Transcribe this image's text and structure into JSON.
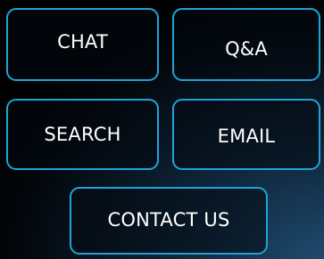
{
  "buttons": {
    "chat": "CHAT",
    "qa": "Q&A",
    "search": "SEARCH",
    "email": "EMAIL",
    "contact": "CONTACT US"
  },
  "colors": {
    "button_border": "#1fa3d9",
    "text": "#ffffff",
    "background_dark": "#000000",
    "background_glow": "#1f4a6e"
  }
}
